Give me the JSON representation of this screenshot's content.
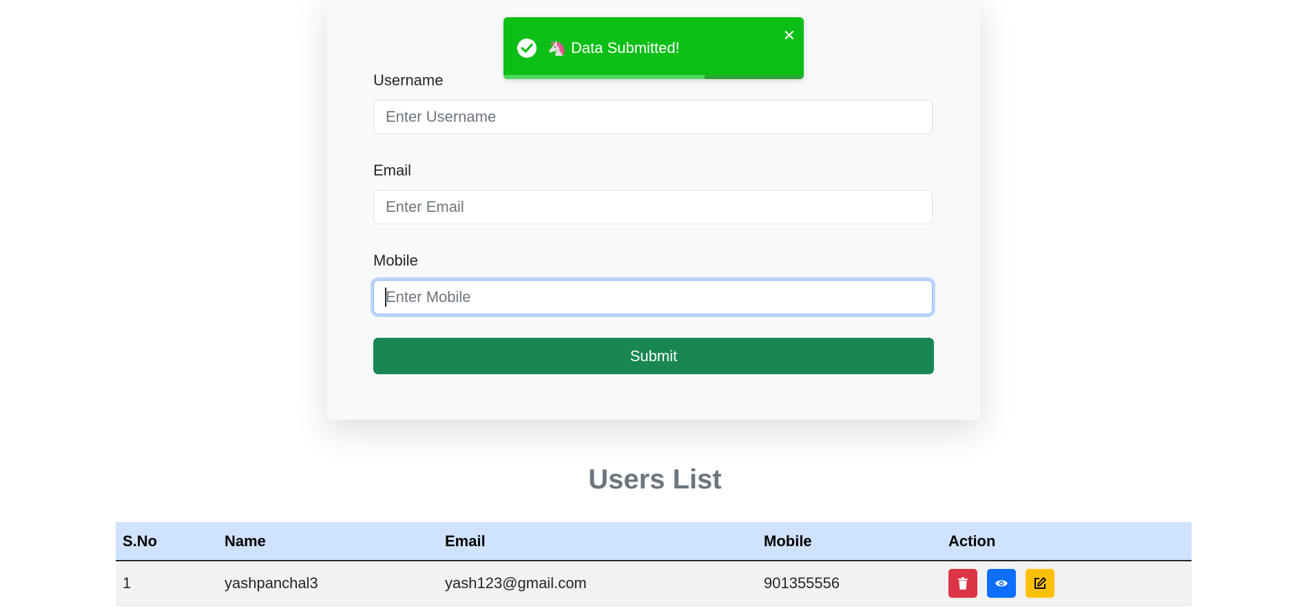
{
  "form": {
    "username_label": "Username",
    "username_placeholder": "Enter Username",
    "email_label": "Email",
    "email_placeholder": "Enter Email",
    "mobile_label": "Mobile",
    "mobile_placeholder": "Enter Mobile",
    "submit_label": "Submit"
  },
  "toast": {
    "message": "Data Submitted!",
    "emoji": "🦄",
    "close_symbol": "✕",
    "icon": "check-circle-icon",
    "progress_fraction": 0.67,
    "color": "#0bbf16"
  },
  "users_list": {
    "title": "Users List",
    "columns": [
      "S.No",
      "Name",
      "Email",
      "Mobile",
      "Action"
    ],
    "rows": [
      {
        "sno": "1",
        "name": "yashpanchal3",
        "email": "yash123@gmail.com",
        "mobile": "901355556"
      }
    ],
    "actions": [
      "trash-icon",
      "eye-icon",
      "edit-icon"
    ]
  },
  "colors": {
    "primary": "#0d6efd",
    "success": "#198754",
    "danger": "#dc3545",
    "warning": "#ffc107",
    "table_header": "#cfe2ff"
  }
}
